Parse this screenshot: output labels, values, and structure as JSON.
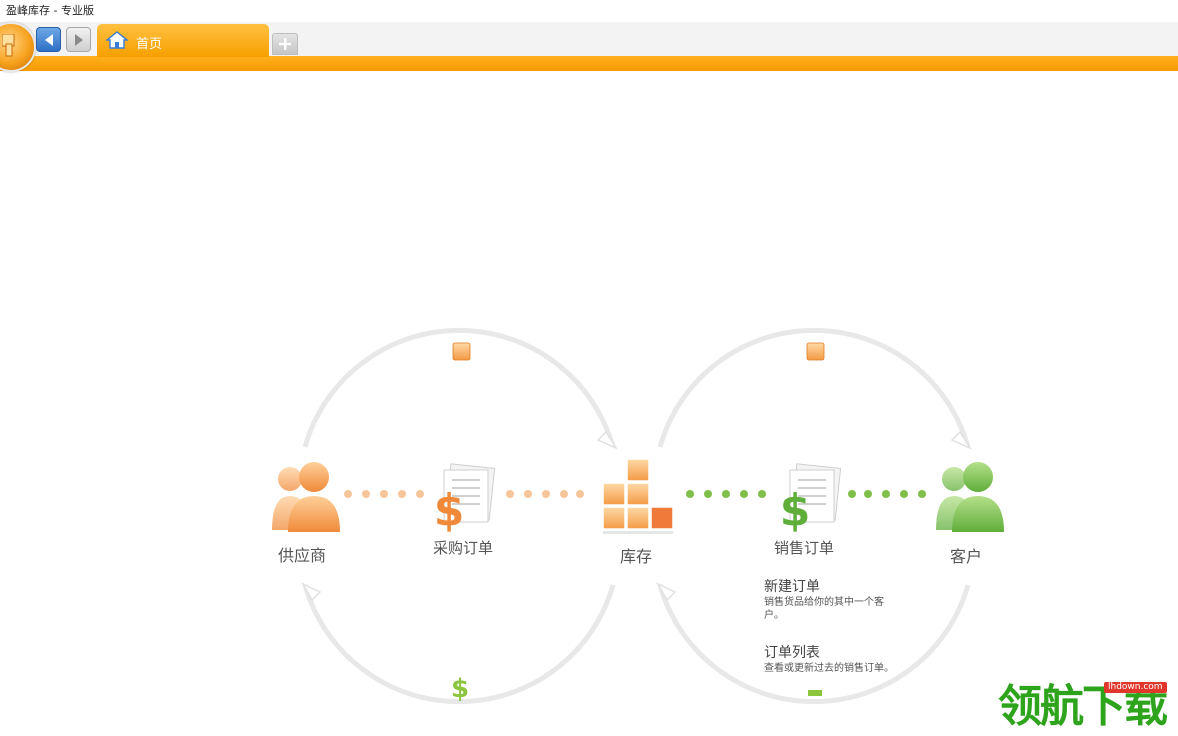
{
  "window": {
    "title": "盈峰库存 - 专业版"
  },
  "tabs": [
    {
      "label": "首页",
      "icon": "home-icon",
      "active": true
    }
  ],
  "colors": {
    "accent": "#f7a000",
    "nav_back": "#2d6fc4",
    "purchase": "#f0a050",
    "sales": "#7fbf4a",
    "arc": "#e6e6e6"
  },
  "flow": {
    "supplier": {
      "label": "供应商",
      "icon": "supplier-people-icon"
    },
    "purchase_order": {
      "label": "采购订单",
      "icon": "purchase-order-document-icon"
    },
    "inventory": {
      "label": "库存",
      "icon": "inventory-blocks-icon"
    },
    "sales_order": {
      "label": "销售订单",
      "icon": "sales-order-document-icon"
    },
    "customer": {
      "label": "客户",
      "icon": "customer-people-icon"
    }
  },
  "sales_menu": {
    "new_order": {
      "title": "新建订单",
      "desc": "销售货品给你的其中一个客户。"
    },
    "order_list": {
      "title": "订单列表",
      "desc": "查看或更新过去的销售订单。"
    }
  },
  "watermark": {
    "text": "领航下载",
    "badge": "lhdown.com"
  }
}
